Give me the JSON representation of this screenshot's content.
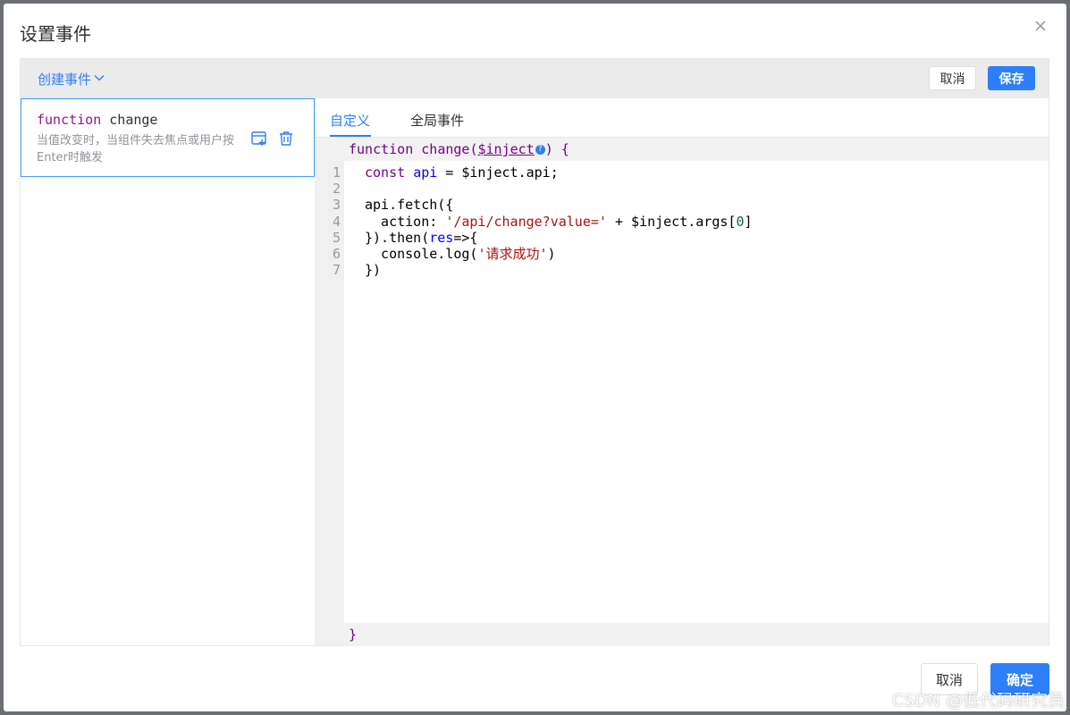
{
  "dialog": {
    "title": "设置事件"
  },
  "toolbar": {
    "create_label": "创建事件",
    "cancel_label": "取消",
    "save_label": "保存"
  },
  "event": {
    "keyword": "function",
    "name": "change",
    "description": "当值改变时，当组件失去焦点或用户按Enter时触发"
  },
  "tabs": {
    "custom": "自定义",
    "global": "全局事件"
  },
  "editor": {
    "head_keyword": "function",
    "head_name": "change(",
    "head_arg": "$inject",
    "head_help": "?",
    "head_tail": ") {",
    "footer": "}",
    "line_numbers": [
      "1",
      "2",
      "3",
      "4",
      "5",
      "6",
      "7"
    ],
    "lines": [
      [
        "const",
        " ",
        "api",
        " = $inject.api;"
      ],
      [
        ""
      ],
      [
        "api.fetch({"
      ],
      [
        "  action: ",
        "'/api/change?value='",
        " + $inject.args[",
        "0",
        "]"
      ],
      [
        "}).then(",
        "res",
        "=>{"
      ],
      [
        "  console.log(",
        "'请求成功'",
        ")"
      ],
      [
        "})"
      ]
    ]
  },
  "footer": {
    "cancel_label": "取消",
    "confirm_label": "确定"
  },
  "watermark": "CSDN @低代码研究员",
  "colors": {
    "accent": "#2d7ff9",
    "keyword": "#770088",
    "string": "#aa1111",
    "definition": "#0000ff"
  }
}
